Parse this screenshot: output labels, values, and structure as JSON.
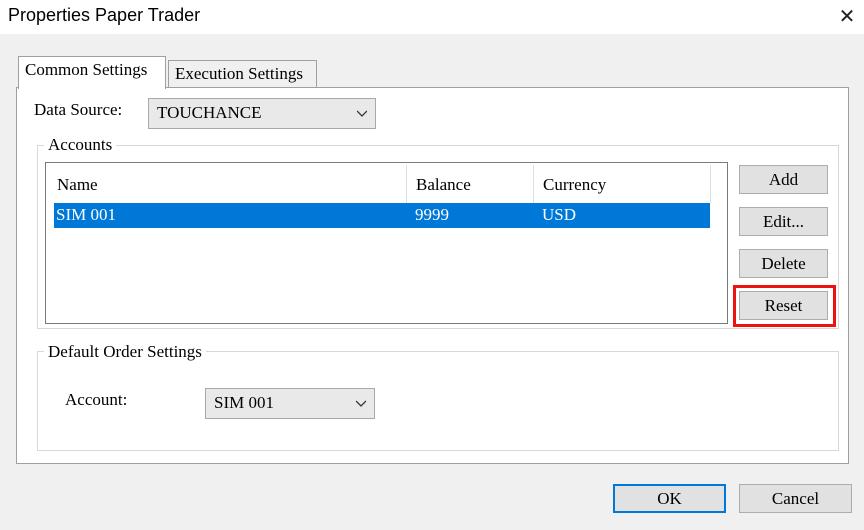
{
  "window": {
    "title": "Properties Paper Trader",
    "close_glyph": "✕"
  },
  "tabs": [
    {
      "label": "Common Settings",
      "active": true
    },
    {
      "label": "Execution Settings",
      "active": false
    }
  ],
  "data_source": {
    "label": "Data Source:",
    "value": "TOUCHANCE"
  },
  "accounts": {
    "group_title": "Accounts",
    "columns": [
      "Name",
      "Balance",
      "Currency"
    ],
    "rows": [
      {
        "name": "SIM 001",
        "balance": "9999",
        "currency": "USD",
        "selected": true
      }
    ],
    "buttons": {
      "add": "Add",
      "edit": "Edit...",
      "delete": "Delete",
      "reset": "Reset"
    }
  },
  "default_order": {
    "group_title": "Default Order Settings",
    "account_label": "Account:",
    "account_value": "SIM 001"
  },
  "footer": {
    "ok": "OK",
    "cancel": "Cancel"
  },
  "colors": {
    "selection": "#0078d7",
    "highlight": "#e11111",
    "ok_border": "#0078d7"
  }
}
